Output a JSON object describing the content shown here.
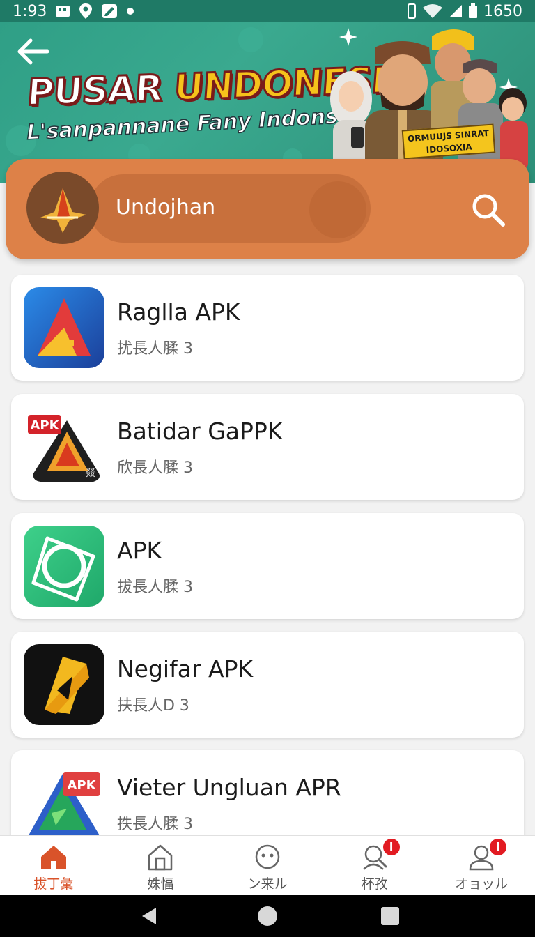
{
  "status_bar": {
    "time": "1:93",
    "battery_text": "1650"
  },
  "banner": {
    "title_part1": "PUSAR ",
    "title_part2": "UNDONESIA",
    "subtitle": "L'sanpannane Fany Indonsia!",
    "badge": "ORMUUJS SINRAT IDOSOXIA"
  },
  "search": {
    "value": "Undojhan"
  },
  "apps": [
    {
      "name": "Raglla APK",
      "meta": "扰長人腬 3",
      "icon": "raglla-app-icon"
    },
    {
      "name": "Batidar GaPPK",
      "meta": "欣長人腬 3",
      "icon": "batidar-apk-icon",
      "icon_tag": "APK",
      "icon_corner": "叕"
    },
    {
      "name": "APK",
      "meta": "拔長人腬 3",
      "icon": "green-star-app-icon"
    },
    {
      "name": "Negifar APK",
      "meta": "扶長人Ⅾ 3",
      "icon": "negifar-app-icon"
    },
    {
      "name": "Vieter Ungluan APR",
      "meta": "抶長人腬 3",
      "icon": "vieter-apk-icon",
      "icon_tag": "APK"
    }
  ],
  "bottom_nav": [
    {
      "label": "拔丁彙",
      "icon": "home-icon",
      "active": true
    },
    {
      "label": "姝愊",
      "icon": "building-icon"
    },
    {
      "label": "ン来ル",
      "icon": "chat-face-icon"
    },
    {
      "label": "杯孜",
      "icon": "search-person-icon",
      "badge": "i"
    },
    {
      "label": "オョッル",
      "icon": "profile-icon",
      "badge": "i"
    }
  ],
  "colors": {
    "banner": "#2f9f86",
    "search_card": "#dd8148",
    "active_nav": "#d9532a",
    "badge": "#e21b22"
  }
}
